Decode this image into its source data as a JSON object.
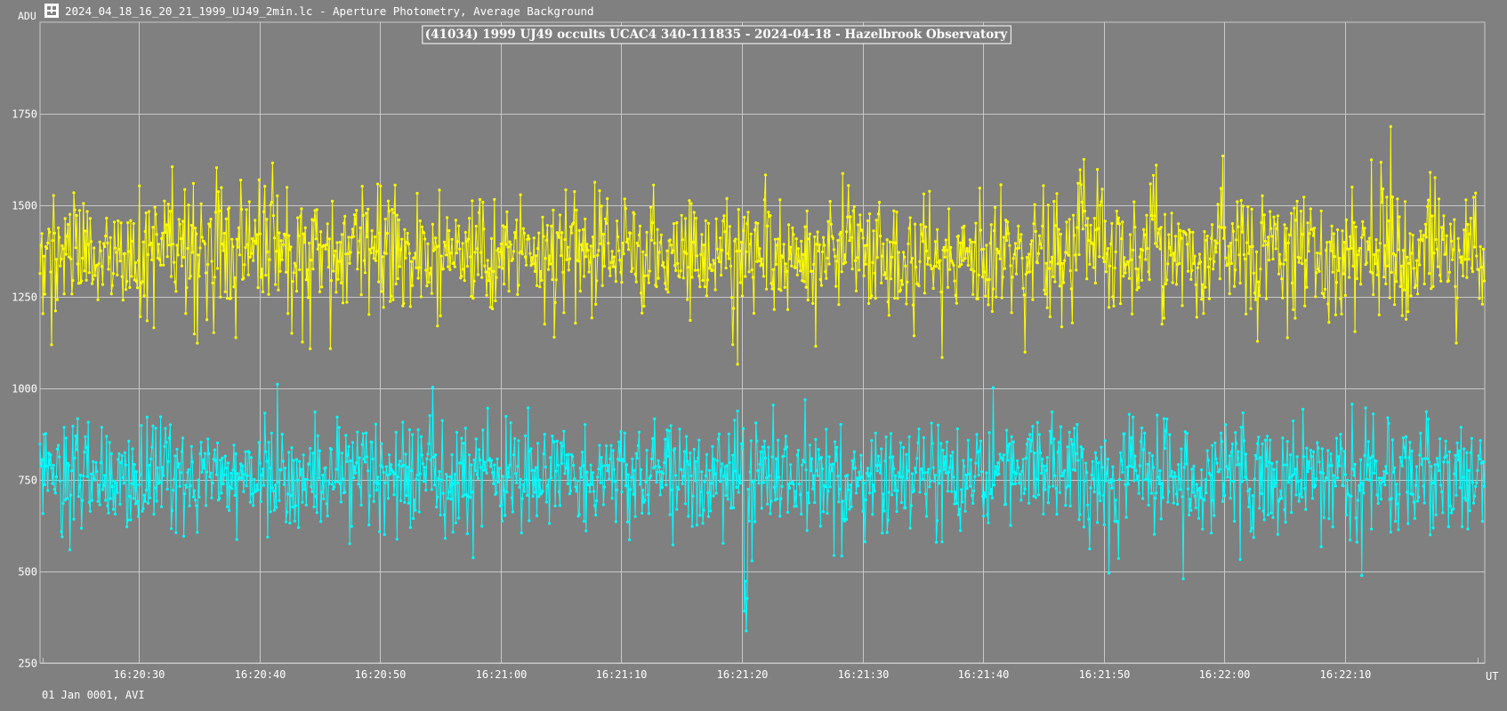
{
  "window": {
    "title": "2024_04_18_16_20_21_1999_UJ49_2min.lc - Aperture Photometry, Average Background",
    "icon": "photometry-app-icon"
  },
  "footer": {
    "date_text": "01 Jan 0001, AVI"
  },
  "colors": {
    "background": "#808080",
    "grid": "#c8c8c8",
    "target": "#ffff00",
    "comparison": "#00ffff",
    "text": "#ffffff"
  },
  "chart_data": {
    "type": "line",
    "title": "(41034) 1999 UJ49 occults UCAC4 340-111835 - 2024-04-18 - Hazelbrook Observatory",
    "ylabel": "ADU",
    "xlabel": "UT",
    "ylim": [
      250,
      2000
    ],
    "xlim": [
      "16:20:21.8",
      "16:22:21.6"
    ],
    "grid": true,
    "y_ticks": [
      250,
      500,
      750,
      1000,
      1250,
      1500,
      1750
    ],
    "x_ticks": [
      "16:20:30",
      "16:20:40",
      "16:20:50",
      "16:21:00",
      "16:21:10",
      "16:21:20",
      "16:21:30",
      "16:21:40",
      "16:21:50",
      "16:22:00",
      "16:22:10"
    ],
    "x_minor_ticks": [
      "16:20:22",
      "16:22:21"
    ],
    "sample_interval_s": 0.08,
    "series": [
      {
        "color": "#ffff00",
        "mean": 1370,
        "sd": 85,
        "range": [
          1020,
          1800
        ],
        "approx_points": 1500
      },
      {
        "color": "#00ffff",
        "mean": 765,
        "sd": 80,
        "range": [
          290,
          1100
        ],
        "approx_points": 1500,
        "event": {
          "time": "16:21:20.3",
          "duration_s": 0.3,
          "min_value": 300
        }
      }
    ]
  }
}
